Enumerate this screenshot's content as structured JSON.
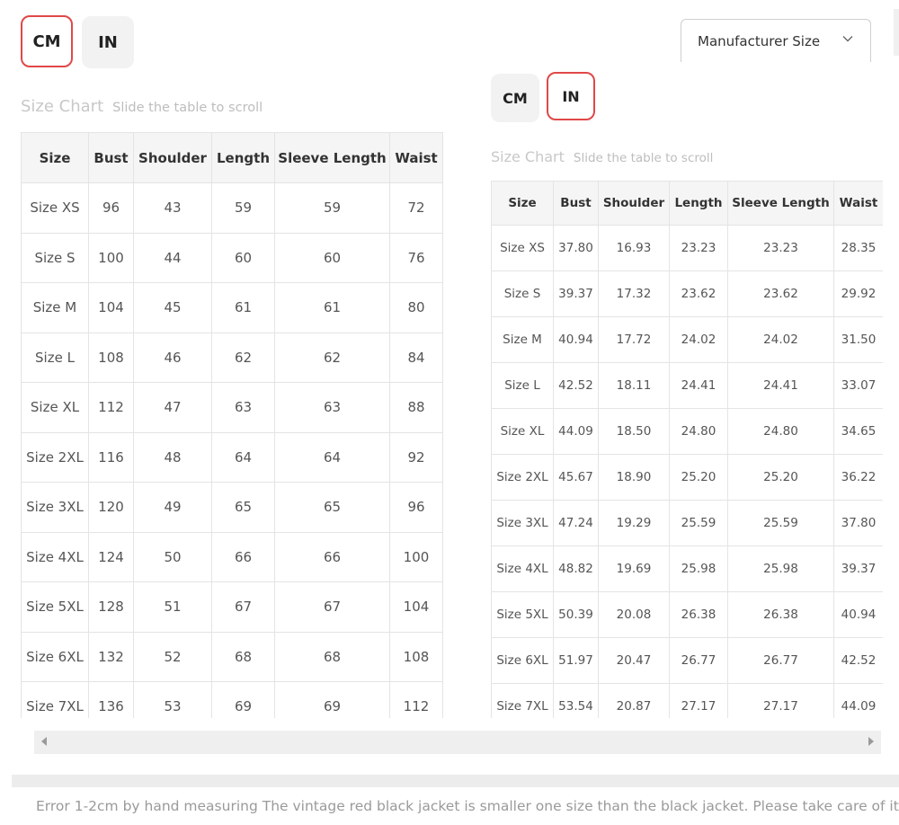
{
  "unit_toggle": {
    "cm_label": "CM",
    "in_label": "IN"
  },
  "size_select": {
    "selected": "Manufacturer Size"
  },
  "chart": {
    "title": "Size Chart",
    "hint": "Slide the table to scroll"
  },
  "columns": [
    "Size",
    "Bust",
    "Shoulder",
    "Length",
    "Sleeve Length",
    "Waist"
  ],
  "cm_rows": [
    [
      "Size XS",
      "96",
      "43",
      "59",
      "59",
      "72"
    ],
    [
      "Size S",
      "100",
      "44",
      "60",
      "60",
      "76"
    ],
    [
      "Size M",
      "104",
      "45",
      "61",
      "61",
      "80"
    ],
    [
      "Size L",
      "108",
      "46",
      "62",
      "62",
      "84"
    ],
    [
      "Size XL",
      "112",
      "47",
      "63",
      "63",
      "88"
    ],
    [
      "Size 2XL",
      "116",
      "48",
      "64",
      "64",
      "92"
    ],
    [
      "Size 3XL",
      "120",
      "49",
      "65",
      "65",
      "96"
    ],
    [
      "Size 4XL",
      "124",
      "50",
      "66",
      "66",
      "100"
    ],
    [
      "Size 5XL",
      "128",
      "51",
      "67",
      "67",
      "104"
    ],
    [
      "Size 6XL",
      "132",
      "52",
      "68",
      "68",
      "108"
    ],
    [
      "Size 7XL",
      "136",
      "53",
      "69",
      "69",
      "112"
    ]
  ],
  "in_rows": [
    [
      "Size XS",
      "37.80",
      "16.93",
      "23.23",
      "23.23",
      "28.35"
    ],
    [
      "Size S",
      "39.37",
      "17.32",
      "23.62",
      "23.62",
      "29.92"
    ],
    [
      "Size M",
      "40.94",
      "17.72",
      "24.02",
      "24.02",
      "31.50"
    ],
    [
      "Size L",
      "42.52",
      "18.11",
      "24.41",
      "24.41",
      "33.07"
    ],
    [
      "Size XL",
      "44.09",
      "18.50",
      "24.80",
      "24.80",
      "34.65"
    ],
    [
      "Size 2XL",
      "45.67",
      "18.90",
      "25.20",
      "25.20",
      "36.22"
    ],
    [
      "Size 3XL",
      "47.24",
      "19.29",
      "25.59",
      "25.59",
      "37.80"
    ],
    [
      "Size 4XL",
      "48.82",
      "19.69",
      "25.98",
      "25.98",
      "39.37"
    ],
    [
      "Size 5XL",
      "50.39",
      "20.08",
      "26.38",
      "26.38",
      "40.94"
    ],
    [
      "Size 6XL",
      "51.97",
      "20.47",
      "26.77",
      "26.77",
      "42.52"
    ],
    [
      "Size 7XL",
      "53.54",
      "20.87",
      "27.17",
      "27.17",
      "44.09"
    ]
  ],
  "footer_note": "Error 1-2cm by hand measuring The vintage red black jacket is smaller one size than the black jacket. Please take care of it.",
  "colors": {
    "active_border": "#e04848",
    "button_bg": "#f2f2f2",
    "header_bg": "#f5f5f5"
  }
}
